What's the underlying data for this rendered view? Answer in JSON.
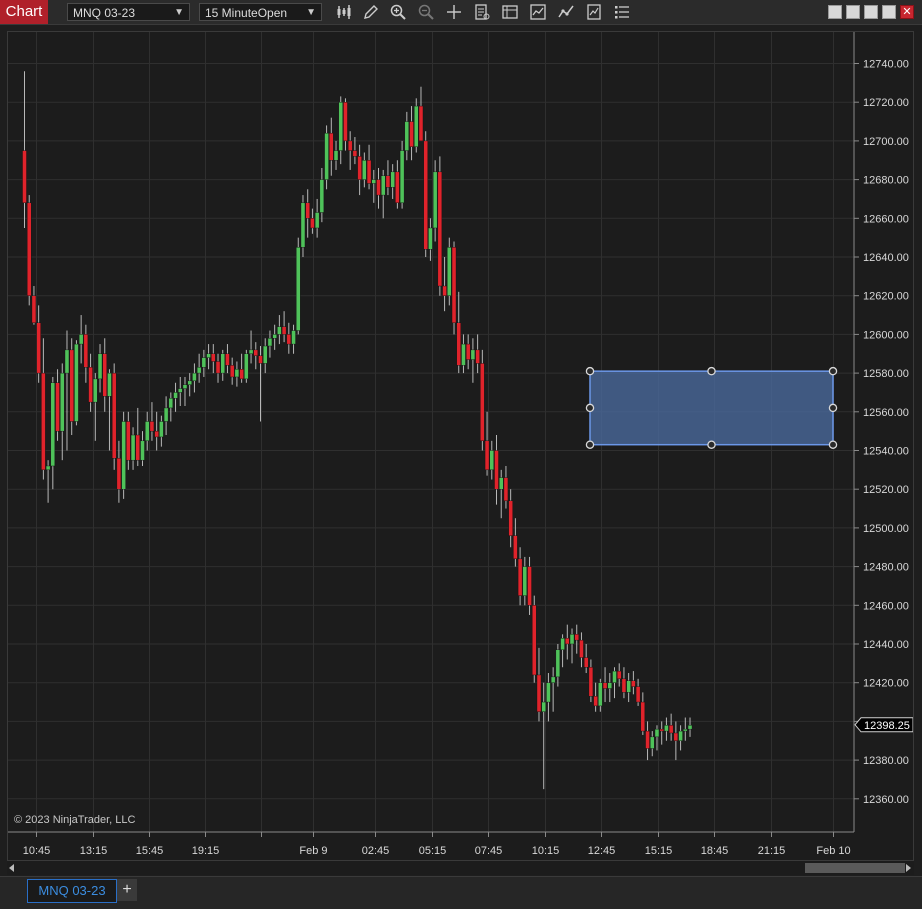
{
  "toolbar": {
    "chart_label": "Chart",
    "instrument": "MNQ 03-23",
    "interval": "15 MinuteOpen",
    "tools": [
      "bars-type-icon",
      "pencil-draw-icon",
      "zoom-in-icon",
      "zoom-out-icon",
      "crosshair-icon",
      "properties-icon",
      "templates-icon",
      "strategies-icon",
      "indicators-icon",
      "data-box-icon",
      "list-icon"
    ]
  },
  "copyright": "© 2023 NinjaTrader, LLC",
  "current_price": "12398.25",
  "tabs": [
    {
      "label": "MNQ 03-23"
    }
  ],
  "add_tab": "+",
  "colors": {
    "up": "#4fc25a",
    "down": "#e0232b",
    "background": "#1c1c1c",
    "grid": "#2f2f2f",
    "rectangle_fill": "#4a6a9e",
    "rectangle_stroke": "#6b97e8"
  },
  "chart_data": {
    "type": "candlestick",
    "ylim": [
      12351,
      12753
    ],
    "y_ticks": [
      12740,
      12720,
      12700,
      12680,
      12660,
      12640,
      12620,
      12600,
      12580,
      12560,
      12540,
      12520,
      12500,
      12480,
      12460,
      12440,
      12420,
      12400,
      12380,
      12360
    ],
    "x_ticks": [
      "10:45",
      "13:15",
      "15:45",
      "19:15",
      "",
      "Feb 9",
      "02:45",
      "05:15",
      "07:45",
      "10:15",
      "12:45",
      "15:15",
      "18:45",
      "21:15",
      "Feb 10"
    ],
    "bars_shown": 181,
    "grid": true,
    "rectangle": {
      "price_top": 12581,
      "price_bottom": 12543,
      "start_bar": 128,
      "end_bar": 181
    },
    "ohlc": [
      [
        12695,
        12736,
        12655,
        12668
      ],
      [
        12668,
        12672,
        12615,
        12620
      ],
      [
        12620,
        12625,
        12605,
        12606
      ],
      [
        12606,
        12615,
        12575,
        12580
      ],
      [
        12580,
        12598,
        12525,
        12530
      ],
      [
        12530,
        12535,
        12513,
        12532
      ],
      [
        12532,
        12578,
        12520,
        12575
      ],
      [
        12575,
        12582,
        12545,
        12550
      ],
      [
        12550,
        12585,
        12535,
        12580
      ],
      [
        12580,
        12602,
        12540,
        12592
      ],
      [
        12592,
        12598,
        12548,
        12555
      ],
      [
        12555,
        12597,
        12553,
        12595
      ],
      [
        12595,
        12610,
        12585,
        12600
      ],
      [
        12600,
        12605,
        12575,
        12583
      ],
      [
        12583,
        12590,
        12560,
        12565
      ],
      [
        12565,
        12580,
        12545,
        12577
      ],
      [
        12577,
        12595,
        12570,
        12590
      ],
      [
        12590,
        12598,
        12560,
        12568
      ],
      [
        12568,
        12582,
        12540,
        12580
      ],
      [
        12580,
        12585,
        12530,
        12536
      ],
      [
        12536,
        12545,
        12513,
        12520
      ],
      [
        12520,
        12560,
        12515,
        12555
      ],
      [
        12555,
        12560,
        12530,
        12535
      ],
      [
        12535,
        12552,
        12530,
        12548
      ],
      [
        12548,
        12562,
        12532,
        12535
      ],
      [
        12535,
        12550,
        12532,
        12545
      ],
      [
        12545,
        12560,
        12540,
        12555
      ],
      [
        12555,
        12565,
        12545,
        12550
      ],
      [
        12550,
        12560,
        12540,
        12547
      ],
      [
        12547,
        12558,
        12542,
        12555
      ],
      [
        12555,
        12568,
        12548,
        12562
      ],
      [
        12562,
        12570,
        12555,
        12567
      ],
      [
        12567,
        12575,
        12560,
        12570
      ],
      [
        12570,
        12578,
        12563,
        12572
      ],
      [
        12572,
        12578,
        12563,
        12574
      ],
      [
        12574,
        12580,
        12568,
        12576
      ],
      [
        12576,
        12585,
        12570,
        12580
      ],
      [
        12580,
        12590,
        12575,
        12583
      ],
      [
        12583,
        12592,
        12578,
        12588
      ],
      [
        12588,
        12595,
        12582,
        12590
      ],
      [
        12590,
        12595,
        12580,
        12586
      ],
      [
        12586,
        12590,
        12575,
        12580
      ],
      [
        12580,
        12592,
        12576,
        12590
      ],
      [
        12590,
        12595,
        12580,
        12584
      ],
      [
        12584,
        12588,
        12574,
        12578
      ],
      [
        12578,
        12586,
        12573,
        12582
      ],
      [
        12582,
        12590,
        12575,
        12577
      ],
      [
        12577,
        12592,
        12575,
        12590
      ],
      [
        12590,
        12602,
        12585,
        12592
      ],
      [
        12592,
        12596,
        12582,
        12589
      ],
      [
        12589,
        12594,
        12555,
        12585
      ],
      [
        12585,
        12598,
        12580,
        12594
      ],
      [
        12594,
        12602,
        12588,
        12598
      ],
      [
        12598,
        12605,
        12592,
        12600
      ],
      [
        12600,
        12610,
        12595,
        12604
      ],
      [
        12604,
        12612,
        12596,
        12600
      ],
      [
        12600,
        12606,
        12590,
        12595
      ],
      [
        12595,
        12605,
        12590,
        12602
      ],
      [
        12602,
        12650,
        12600,
        12645
      ],
      [
        12645,
        12672,
        12640,
        12668
      ],
      [
        12668,
        12675,
        12650,
        12660
      ],
      [
        12660,
        12665,
        12652,
        12655
      ],
      [
        12655,
        12670,
        12650,
        12663
      ],
      [
        12663,
        12686,
        12658,
        12680
      ],
      [
        12680,
        12708,
        12675,
        12704
      ],
      [
        12704,
        12712,
        12682,
        12690
      ],
      [
        12690,
        12700,
        12685,
        12695
      ],
      [
        12695,
        12723,
        12688,
        12720
      ],
      [
        12720,
        12722,
        12695,
        12700
      ],
      [
        12700,
        12705,
        12685,
        12695
      ],
      [
        12695,
        12702,
        12688,
        12692
      ],
      [
        12692,
        12698,
        12672,
        12680
      ],
      [
        12680,
        12694,
        12676,
        12690
      ],
      [
        12690,
        12698,
        12675,
        12678
      ],
      [
        12678,
        12685,
        12668,
        12680
      ],
      [
        12680,
        12686,
        12665,
        12672
      ],
      [
        12672,
        12685,
        12660,
        12682
      ],
      [
        12682,
        12690,
        12672,
        12676
      ],
      [
        12676,
        12688,
        12670,
        12684
      ],
      [
        12684,
        12690,
        12665,
        12668
      ],
      [
        12668,
        12700,
        12665,
        12695
      ],
      [
        12695,
        12715,
        12690,
        12710
      ],
      [
        12710,
        12718,
        12690,
        12697
      ],
      [
        12697,
        12722,
        12694,
        12718
      ],
      [
        12718,
        12728,
        12702,
        12700
      ],
      [
        12700,
        12705,
        12640,
        12644
      ],
      [
        12644,
        12660,
        12638,
        12655
      ],
      [
        12655,
        12690,
        12648,
        12684
      ],
      [
        12684,
        12692,
        12620,
        12625
      ],
      [
        12625,
        12640,
        12612,
        12620
      ],
      [
        12620,
        12650,
        12615,
        12645
      ],
      [
        12645,
        12648,
        12600,
        12606
      ],
      [
        12606,
        12622,
        12580,
        12584
      ],
      [
        12584,
        12600,
        12580,
        12595
      ],
      [
        12595,
        12600,
        12582,
        12587
      ],
      [
        12587,
        12598,
        12575,
        12592
      ],
      [
        12592,
        12600,
        12580,
        12585
      ],
      [
        12585,
        12592,
        12540,
        12545
      ],
      [
        12545,
        12560,
        12527,
        12530
      ],
      [
        12530,
        12545,
        12525,
        12540
      ],
      [
        12540,
        12548,
        12512,
        12520
      ],
      [
        12520,
        12530,
        12505,
        12526
      ],
      [
        12526,
        12532,
        12510,
        12514
      ],
      [
        12514,
        12520,
        12490,
        12496
      ],
      [
        12496,
        12505,
        12480,
        12484
      ],
      [
        12484,
        12490,
        12460,
        12465
      ],
      [
        12465,
        12485,
        12460,
        12480
      ],
      [
        12480,
        12485,
        12455,
        12460
      ],
      [
        12460,
        12465,
        12420,
        12424
      ],
      [
        12424,
        12438,
        12400,
        12405
      ],
      [
        12405,
        12420,
        12365,
        12410
      ],
      [
        12410,
        12425,
        12400,
        12420
      ],
      [
        12420,
        12428,
        12405,
        12423
      ],
      [
        12423,
        12440,
        12418,
        12437
      ],
      [
        12437,
        12445,
        12428,
        12443
      ],
      [
        12443,
        12450,
        12432,
        12440
      ],
      [
        12440,
        12448,
        12430,
        12445
      ],
      [
        12445,
        12450,
        12435,
        12442
      ],
      [
        12442,
        12446,
        12428,
        12433
      ],
      [
        12433,
        12440,
        12425,
        12428
      ],
      [
        12428,
        12432,
        12410,
        12413
      ],
      [
        12413,
        12420,
        12405,
        12408
      ],
      [
        12408,
        12422,
        12405,
        12420
      ],
      [
        12420,
        12428,
        12410,
        12417
      ],
      [
        12417,
        12425,
        12410,
        12420
      ],
      [
        12420,
        12428,
        12412,
        12426
      ],
      [
        12426,
        12430,
        12418,
        12422
      ],
      [
        12422,
        12428,
        12412,
        12415
      ],
      [
        12415,
        12425,
        12410,
        12421
      ],
      [
        12421,
        12426,
        12414,
        12418
      ],
      [
        12418,
        12422,
        12408,
        12410
      ],
      [
        12410,
        12415,
        12393,
        12395
      ],
      [
        12395,
        12400,
        12380,
        12386
      ],
      [
        12386,
        12395,
        12382,
        12392
      ],
      [
        12392,
        12398,
        12385,
        12396
      ],
      [
        12396,
        12400,
        12388,
        12395
      ],
      [
        12395,
        12402,
        12390,
        12398
      ],
      [
        12398,
        12404,
        12390,
        12394
      ],
      [
        12394,
        12400,
        12380,
        12390
      ],
      [
        12390,
        12398,
        12385,
        12395
      ],
      [
        12395,
        12402,
        12390,
        12396
      ],
      [
        12396,
        12402,
        12392,
        12398
      ]
    ]
  }
}
